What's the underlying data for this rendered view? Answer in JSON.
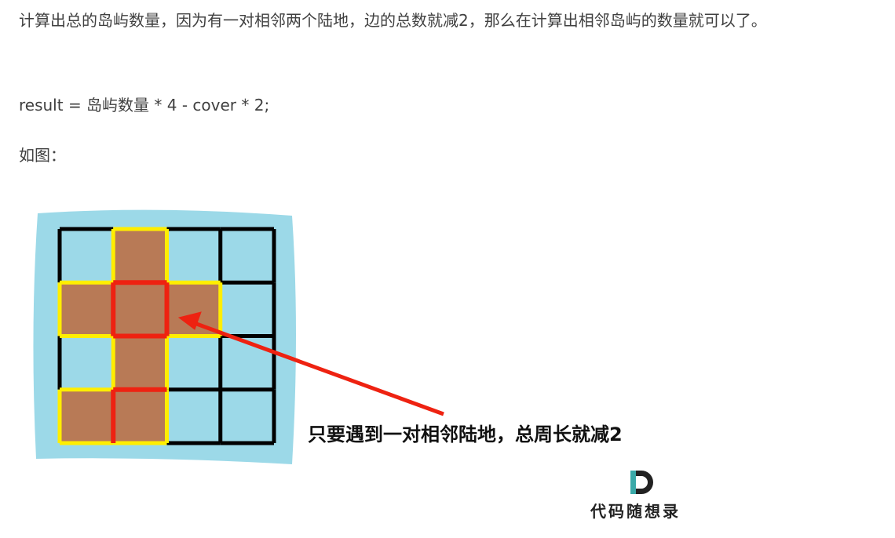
{
  "paragraphs": {
    "p1": "计算出总的岛屿数量，因为有一对相邻两个陆地，边的总数就减2，那么在计算出相邻岛屿的数量就可以了。",
    "p2": "result = 岛屿数量 * 4 - cover * 2;",
    "p3": "如图："
  },
  "figure": {
    "caption": "只要遇到一对相邻陆地，总周长就减2",
    "logo_text": "代码随想录",
    "grid": [
      [
        0,
        1,
        0,
        0
      ],
      [
        1,
        1,
        1,
        0
      ],
      [
        0,
        1,
        0,
        0
      ],
      [
        1,
        1,
        0,
        0
      ]
    ],
    "colors": {
      "water": "#9cd9e8",
      "land": "#b87a56",
      "edge": "#ffee00",
      "cover": "#ee2211",
      "grid": "#000000"
    }
  }
}
